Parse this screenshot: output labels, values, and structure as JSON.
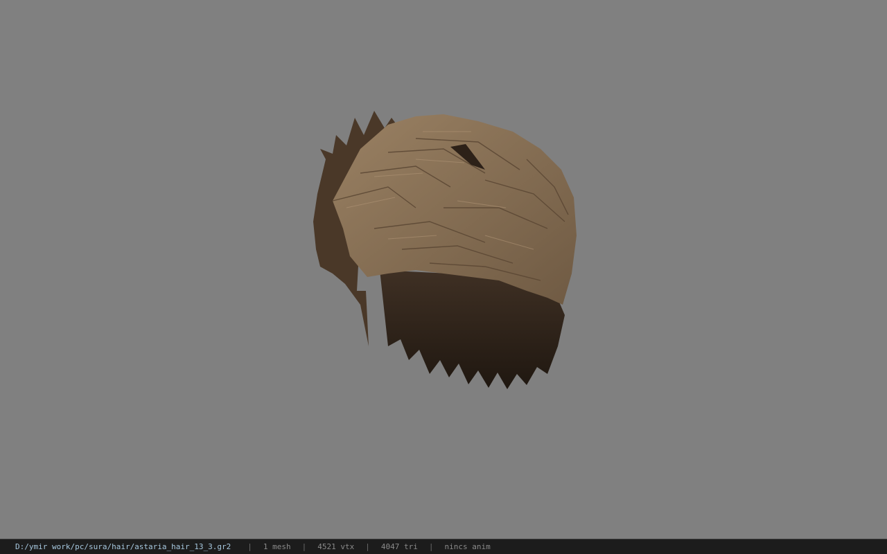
{
  "viewport": {
    "background": "#808080",
    "model": {
      "icon": "hair-mesh-model",
      "colors": {
        "light": "#8b7458",
        "mid": "#6b563f",
        "dark": "#3a2c20",
        "shadow": "#1f1710"
      }
    }
  },
  "statusbar": {
    "path": "D:/ymir work/pc/sura/hair/astaria_hair_13_3.gr2",
    "separator": "|",
    "mesh_count": "1 mesh",
    "vertex_count": "4521 vtx",
    "triangle_count": "4047 tri",
    "anim": "nincs anim"
  }
}
